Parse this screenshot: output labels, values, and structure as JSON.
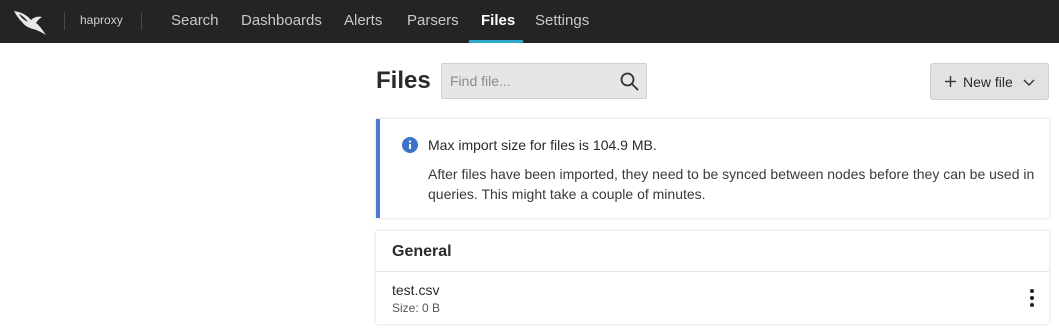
{
  "header": {
    "logo": "falcon-logo-icon",
    "repository": "haproxy",
    "nav": [
      {
        "label": "Search"
      },
      {
        "label": "Dashboards"
      },
      {
        "label": "Alerts"
      },
      {
        "label": "Parsers"
      },
      {
        "label": "Files",
        "active": true
      },
      {
        "label": "Settings"
      }
    ],
    "accent_color": "#2fa7c6"
  },
  "main": {
    "title": "Files",
    "search": {
      "placeholder": "Find file...",
      "value": "",
      "icon": "search-icon"
    },
    "new_file_button": {
      "label": "New file",
      "icon": "plus-icon",
      "dropdown_icon": "chevron-down-icon"
    }
  },
  "info": {
    "icon": "info-icon",
    "line1": "Max import size for files is 104.9 MB.",
    "line2": "After files have been imported, they need to be synced between nodes before they can be used in queries. This might take a couple of minutes.",
    "accent_color": "#4a7bd0"
  },
  "general": {
    "title": "General",
    "files": [
      {
        "name": "test.csv",
        "size": "Size: 0 B",
        "menu_icon": "kebab-menu-icon"
      }
    ]
  }
}
